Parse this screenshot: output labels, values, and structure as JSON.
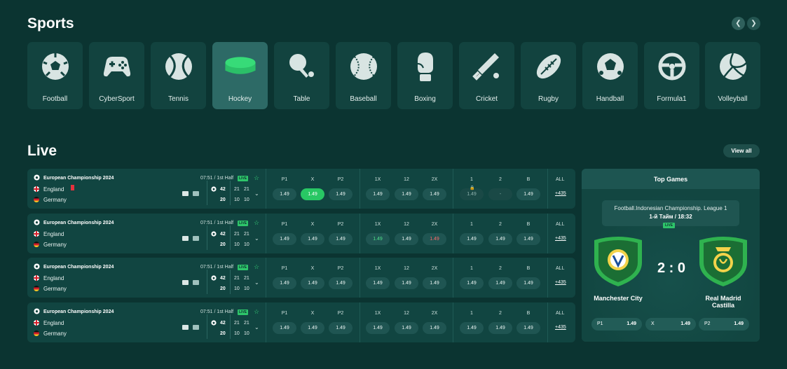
{
  "sports_section": {
    "title": "Sports",
    "prev_icon": "chevron-left-icon",
    "next_icon": "chevron-right-icon",
    "items": [
      {
        "label": "Football",
        "icon": "football-icon"
      },
      {
        "label": "CyberSport",
        "icon": "gamepad-icon"
      },
      {
        "label": "Tennis",
        "icon": "tennis-ball-icon"
      },
      {
        "label": "Hockey",
        "icon": "hockey-puck-icon",
        "active": true
      },
      {
        "label": "Table",
        "icon": "table-tennis-icon"
      },
      {
        "label": "Baseball",
        "icon": "baseball-icon"
      },
      {
        "label": "Boxing",
        "icon": "boxing-glove-icon"
      },
      {
        "label": "Cricket",
        "icon": "cricket-bat-icon"
      },
      {
        "label": "Rugby",
        "icon": "rugby-ball-icon"
      },
      {
        "label": "Handball",
        "icon": "handball-icon"
      },
      {
        "label": "Formula1",
        "icon": "steering-wheel-icon"
      },
      {
        "label": "Volleyball",
        "icon": "volleyball-icon"
      }
    ]
  },
  "live_section": {
    "title": "Live",
    "view_all": "View all"
  },
  "matches": [
    {
      "league": "European Championship 2024",
      "time": "07:51 / 1st Half",
      "live": "LIVE",
      "team1": "England",
      "team2": "Germany",
      "red_card": true,
      "score_main": [
        "42",
        "20"
      ],
      "sets1": [
        "21",
        "21"
      ],
      "sets2": [
        "10",
        "10"
      ],
      "markets": {
        "p1": "P1",
        "x": "X",
        "p2": "P2",
        "d1x": "1X",
        "d12": "12",
        "d2x": "2X",
        "h1": "1",
        "h2": "2",
        "hb": "B",
        "all": "ALL"
      },
      "odds": [
        "1.49",
        "1.49",
        "1.49",
        "1.49",
        "1.49",
        "1.49",
        "1.49",
        "-",
        "1.49"
      ],
      "all_count": "+435"
    },
    {
      "league": "European Championship 2024",
      "time": "07:51 / 1st Half",
      "live": "LIVE",
      "team1": "England",
      "team2": "Germany",
      "score_main": [
        "42",
        "20"
      ],
      "sets1": [
        "21",
        "21"
      ],
      "sets2": [
        "10",
        "10"
      ],
      "markets": {
        "p1": "P1",
        "x": "X",
        "p2": "P2",
        "d1x": "1X",
        "d12": "12",
        "d2x": "2X",
        "h1": "1",
        "h2": "2",
        "hb": "B",
        "all": "ALL"
      },
      "odds": [
        "1.49",
        "1.49",
        "1.49",
        "1.49",
        "1.49",
        "1.49",
        "1.49",
        "1.49",
        "1.49"
      ],
      "all_count": "+435"
    },
    {
      "league": "European Championship 2024",
      "time": "07:51 / 1st Half",
      "live": "LIVE",
      "team1": "England",
      "team2": "Germany",
      "score_main": [
        "42",
        "20"
      ],
      "sets1": [
        "21",
        "21"
      ],
      "sets2": [
        "10",
        "10"
      ],
      "markets": {
        "p1": "P1",
        "x": "X",
        "p2": "P2",
        "d1x": "1X",
        "d12": "12",
        "d2x": "2X",
        "h1": "1",
        "h2": "2",
        "hb": "B",
        "all": "ALL"
      },
      "odds": [
        "1.49",
        "1.49",
        "1.49",
        "1.49",
        "1.49",
        "1.49",
        "1.49",
        "1.49",
        "1.49"
      ],
      "all_count": "+435"
    },
    {
      "league": "European Championship 2024",
      "time": "07:51 / 1st Half",
      "live": "LIVE",
      "team1": "England",
      "team2": "Germany",
      "score_main": [
        "42",
        "20"
      ],
      "sets1": [
        "21",
        "21"
      ],
      "sets2": [
        "10",
        "10"
      ],
      "markets": {
        "p1": "P1",
        "x": "X",
        "p2": "P2",
        "d1x": "1X",
        "d12": "12",
        "d2x": "2X",
        "h1": "1",
        "h2": "2",
        "hb": "B",
        "all": "ALL"
      },
      "odds": [
        "1.49",
        "1.49",
        "1.49",
        "1.49",
        "1.49",
        "1.49",
        "1.49",
        "1.49",
        "1.49"
      ],
      "all_count": "+435"
    }
  ],
  "top_games": {
    "title": "Top Games",
    "league": "Football.Indonesian Championship. League 1",
    "time": "1-й Тайм / 18:32",
    "live": "LIVE",
    "team1": "Manchester City",
    "team2": "Real Madrid Castilla",
    "score": "2 : 0",
    "odds": [
      {
        "k": "P1",
        "v": "1.49"
      },
      {
        "k": "X",
        "v": "1.49"
      },
      {
        "k": "P2",
        "v": "1.49"
      }
    ]
  },
  "colors": {
    "accent": "#28c764",
    "background": "#0b3431",
    "card": "#114541",
    "active_card": "#2d6a66",
    "crest_green": "#2fb24f"
  }
}
